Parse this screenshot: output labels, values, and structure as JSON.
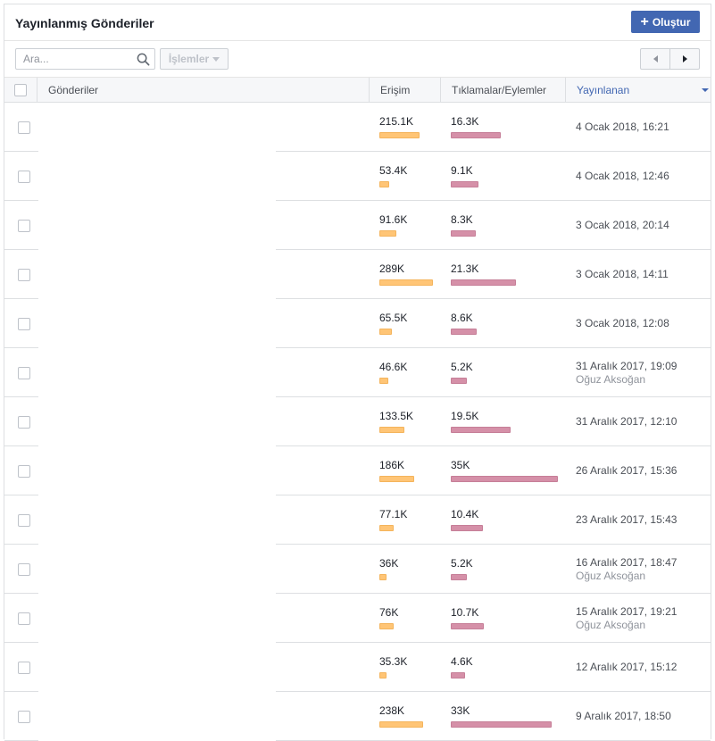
{
  "header": {
    "title": "Yayınlanmış Gönderiler",
    "create_label": "Oluştur"
  },
  "toolbar": {
    "search_placeholder": "Ara...",
    "actions_label": "İşlemler"
  },
  "columns": {
    "posts": "Gönderiler",
    "reach": "Erişim",
    "clicks": "Tıklamalar/Eylemler",
    "published": "Yayınlanan"
  },
  "colors": {
    "accent": "#4267b2",
    "reach_bar": "#ffc576",
    "clicks_bar": "#d590a8"
  },
  "rows": [
    {
      "reach": "215.1K",
      "reach_value": 215100,
      "clicks": "16.3K",
      "clicks_value": 16300,
      "date": "4 Ocak 2018, 16:21",
      "author": ""
    },
    {
      "reach": "53.4K",
      "reach_value": 53400,
      "clicks": "9.1K",
      "clicks_value": 9100,
      "date": "4 Ocak 2018, 12:46",
      "author": ""
    },
    {
      "reach": "91.6K",
      "reach_value": 91600,
      "clicks": "8.3K",
      "clicks_value": 8300,
      "date": "3 Ocak 2018, 20:14",
      "author": ""
    },
    {
      "reach": "289K",
      "reach_value": 289000,
      "clicks": "21.3K",
      "clicks_value": 21300,
      "date": "3 Ocak 2018, 14:11",
      "author": ""
    },
    {
      "reach": "65.5K",
      "reach_value": 65500,
      "clicks": "8.6K",
      "clicks_value": 8600,
      "date": "3 Ocak 2018, 12:08",
      "author": ""
    },
    {
      "reach": "46.6K",
      "reach_value": 46600,
      "clicks": "5.2K",
      "clicks_value": 5200,
      "date": "31 Aralık 2017, 19:09",
      "author": "Oğuz Aksoğan"
    },
    {
      "reach": "133.5K",
      "reach_value": 133500,
      "clicks": "19.5K",
      "clicks_value": 19500,
      "date": "31 Aralık 2017, 12:10",
      "author": ""
    },
    {
      "reach": "186K",
      "reach_value": 186000,
      "clicks": "35K",
      "clicks_value": 35000,
      "date": "26 Aralık 2017, 15:36",
      "author": ""
    },
    {
      "reach": "77.1K",
      "reach_value": 77100,
      "clicks": "10.4K",
      "clicks_value": 10400,
      "date": "23 Aralık 2017, 15:43",
      "author": ""
    },
    {
      "reach": "36K",
      "reach_value": 36000,
      "clicks": "5.2K",
      "clicks_value": 5200,
      "date": "16 Aralık 2017, 18:47",
      "author": "Oğuz Aksoğan"
    },
    {
      "reach": "76K",
      "reach_value": 76000,
      "clicks": "10.7K",
      "clicks_value": 10700,
      "date": "15 Aralık 2017, 19:21",
      "author": "Oğuz Aksoğan"
    },
    {
      "reach": "35.3K",
      "reach_value": 35300,
      "clicks": "4.6K",
      "clicks_value": 4600,
      "date": "12 Aralık 2017, 15:12",
      "author": ""
    },
    {
      "reach": "238K",
      "reach_value": 238000,
      "clicks": "33K",
      "clicks_value": 33000,
      "date": "9 Aralık 2017, 18:50",
      "author": ""
    }
  ]
}
